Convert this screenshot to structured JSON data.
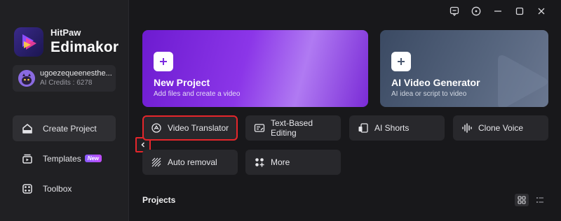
{
  "app": {
    "brand_line1": "HitPaw",
    "brand_line2": "Edimakor"
  },
  "user": {
    "name": "ugoezequeenesthe...",
    "credits": "AI Credits : 6278"
  },
  "sidebar": {
    "items": [
      {
        "label": "Create Project",
        "icon": "home-icon",
        "active": true
      },
      {
        "label": "Templates",
        "icon": "templates-icon",
        "badge": "New"
      },
      {
        "label": "Toolbox",
        "icon": "toolbox-icon"
      }
    ]
  },
  "window_controls": [
    "feedback-icon",
    "info-icon",
    "minimize-icon",
    "maximize-icon",
    "close-icon"
  ],
  "hero": {
    "new_project": {
      "title": "New Project",
      "subtitle": "Add files and create a video"
    },
    "ai_video": {
      "title": "AI Video Generator",
      "subtitle": "AI idea or script to video"
    }
  },
  "tools": [
    {
      "label": "Video Translator",
      "icon": "translate-icon",
      "highlighted": true
    },
    {
      "label": "Text-Based Editing",
      "icon": "text-edit-icon"
    },
    {
      "label": "AI Shorts",
      "icon": "ai-shorts-icon"
    },
    {
      "label": "Clone Voice",
      "icon": "voice-wave-icon"
    },
    {
      "label": "Auto removal",
      "icon": "auto-removal-icon"
    },
    {
      "label": "More",
      "icon": "more-grid-icon"
    }
  ],
  "projects": {
    "title": "Projects"
  },
  "colors": {
    "accent_purple": "#7b2be0",
    "highlight_red": "#e5262b",
    "background": "#18181b"
  }
}
